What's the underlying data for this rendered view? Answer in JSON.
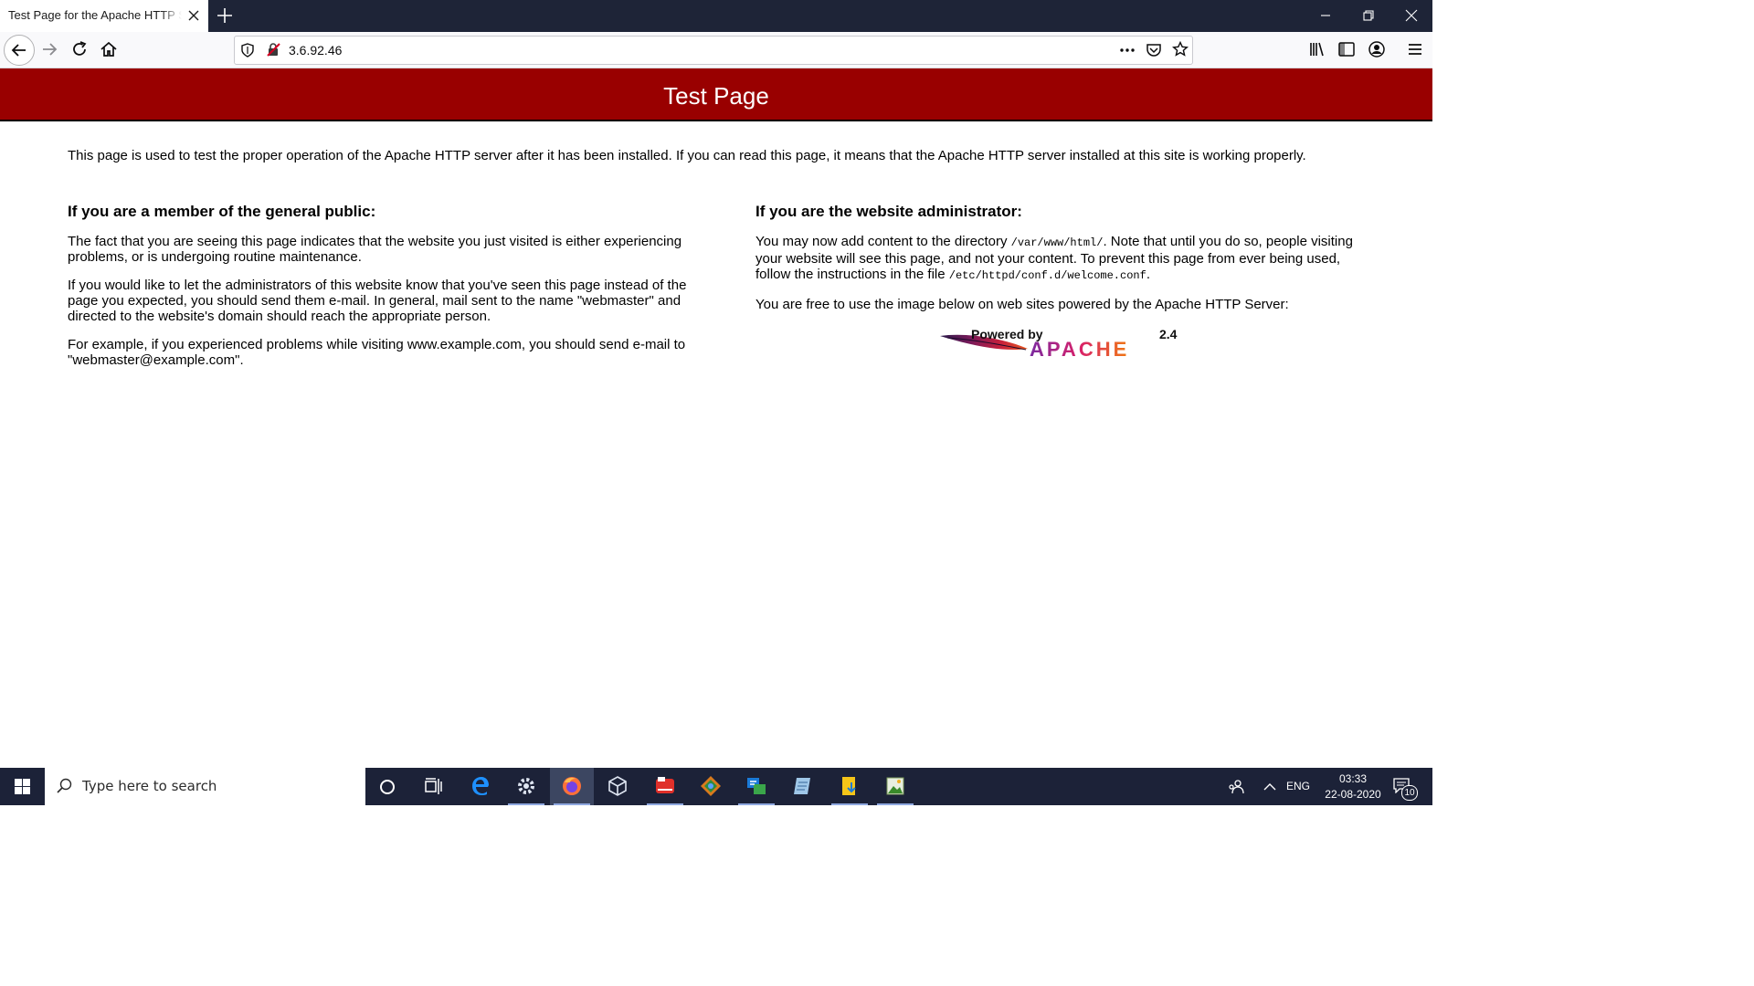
{
  "browser": {
    "tab_title": "Test Page for the Apache HTTP Server",
    "url": "3.6.92.46"
  },
  "page": {
    "banner_title": "Test Page",
    "intro": "This page is used to test the proper operation of the Apache HTTP server after it has been installed. If you can read this page, it means that the Apache HTTP server installed at this site is working properly.",
    "public": {
      "heading": "If you are a member of the general public:",
      "p1": "The fact that you are seeing this page indicates that the website you just visited is either experiencing problems, or is undergoing routine maintenance.",
      "p2": "If you would like to let the administrators of this website know that you've seen this page instead of the page you expected, you should send them e-mail. In general, mail sent to the name \"webmaster\" and directed to the website's domain should reach the appropriate person.",
      "p3": "For example, if you experienced problems while visiting www.example.com, you should send e-mail to \"webmaster@example.com\"."
    },
    "admin": {
      "heading": "If you are the website administrator:",
      "p1_a": "You may now add content to the directory ",
      "p1_dir": "/var/www/html/",
      "p1_b": ". Note that until you do so, people visiting your website will see this page, and not your content. To prevent this page from ever being used, follow the instructions in the file ",
      "p1_file": "/etc/httpd/conf.d/welcome.conf",
      "p1_c": ".",
      "p2": "You are free to use the image below on web sites powered by the Apache HTTP Server:"
    },
    "logo": {
      "powered": "Powered by",
      "version": "2.4",
      "brand": "APACHE"
    }
  },
  "taskbar": {
    "search_placeholder": "Type here to search",
    "language": "ENG",
    "time": "03:33",
    "date": "22-08-2020",
    "notifications": "10"
  }
}
